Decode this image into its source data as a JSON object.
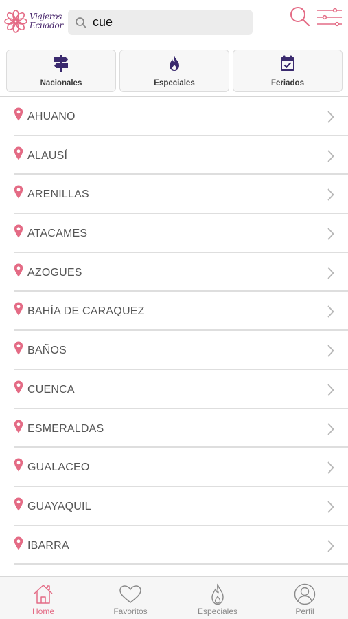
{
  "header": {
    "logo_text_line1": "Viajeros",
    "logo_text_line2": "Ecuador",
    "search_value": "cue",
    "search_icon": "search-icon",
    "filter_icon": "sliders-icon"
  },
  "categories": [
    {
      "label": "Nacionales",
      "icon": "signpost-icon"
    },
    {
      "label": "Especiales",
      "icon": "flame-icon"
    },
    {
      "label": "Feriados",
      "icon": "calendar-check-icon"
    }
  ],
  "places": [
    "AHUANO",
    "ALAUSÍ",
    "ARENILLAS",
    "ATACAMES",
    "AZOGUES",
    "BAHÍA DE CARAQUEZ",
    "BAÑOS",
    "CUENCA",
    "ESMERALDAS",
    "GUALACEO",
    "GUAYAQUIL",
    "IBARRA"
  ],
  "nav": [
    {
      "label": "Home",
      "icon": "home-icon",
      "active": true
    },
    {
      "label": "Favoritos",
      "icon": "heart-icon",
      "active": false
    },
    {
      "label": "Especiales",
      "icon": "flame-icon",
      "active": false
    },
    {
      "label": "Perfil",
      "icon": "user-icon",
      "active": false
    }
  ],
  "colors": {
    "accent": "#e46b85",
    "brand_purple": "#4b2a6e",
    "nav_inactive": "#8a8a8a"
  }
}
